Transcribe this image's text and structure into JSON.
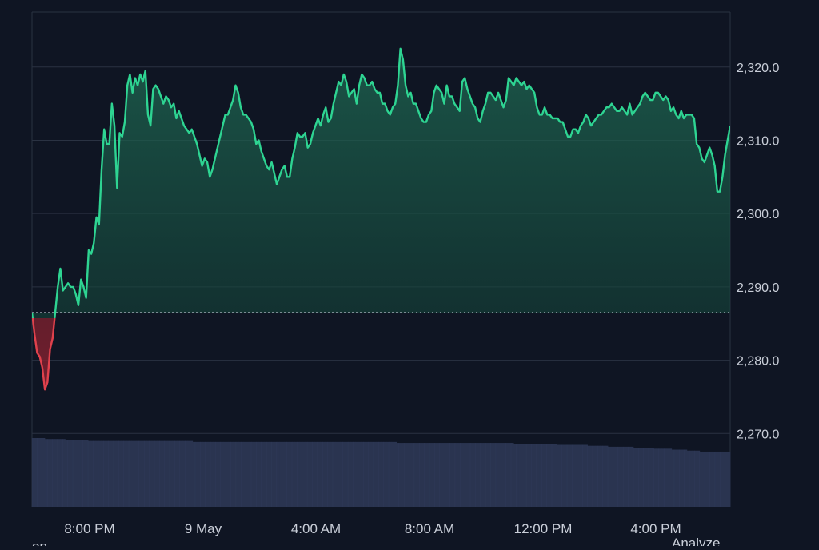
{
  "chart_data": {
    "type": "line",
    "baseline": 2286.5,
    "ylim": [
      2260,
      2327.5
    ],
    "y_ticks": [
      {
        "value": 2270,
        "label": "2,270.0"
      },
      {
        "value": 2280,
        "label": "2,280.0"
      },
      {
        "value": 2290,
        "label": "2,290.0"
      },
      {
        "value": 2300,
        "label": "2,300.0"
      },
      {
        "value": 2310,
        "label": "2,310.0"
      },
      {
        "value": 2320,
        "label": "2,320.0"
      }
    ],
    "x_ticks": [
      "8:00 PM",
      "9 May",
      "4:00 AM",
      "8:00 AM",
      "12:00 PM",
      "4:00 PM"
    ],
    "partial_labels": {
      "left": "on",
      "right": "Analyze"
    },
    "colors": {
      "up": "#2ed492",
      "down": "#e0414c",
      "volume": "#2a3450",
      "grid": "#2a3242",
      "baseline": "#b8bfcc"
    },
    "series": [
      {
        "values": [
          2286.5,
          2283.5,
          2281,
          2280.5,
          2279,
          2276,
          2277,
          2281.5,
          2283,
          2286.5,
          2290,
          2292.5,
          2289.5,
          2290,
          2290.5,
          2290,
          2290,
          2289,
          2287.5,
          2291,
          2290,
          2288.5,
          2295,
          2294.5,
          2296,
          2299.5,
          2298.5,
          2306,
          2311.5,
          2309.5,
          2309.5,
          2315,
          2312,
          2303.5,
          2311,
          2310.5,
          2312.5,
          2317.5,
          2319,
          2316.5,
          2318.5,
          2317.5,
          2319,
          2318,
          2319.5,
          2313.5,
          2312,
          2317,
          2317.5,
          2317,
          2316,
          2315,
          2316,
          2315.5,
          2314.5,
          2315,
          2313,
          2314,
          2313,
          2312,
          2311.5,
          2311,
          2311.5,
          2310.5,
          2309.5,
          2308,
          2306.5,
          2307.5,
          2307,
          2305,
          2306,
          2307.5,
          2309,
          2310.5,
          2312,
          2313.5,
          2313.5,
          2314.5,
          2315.5,
          2317.5,
          2316.5,
          2314.5,
          2313.5,
          2313.5,
          2313,
          2312.5,
          2311.5,
          2309.5,
          2310,
          2308.5,
          2307.5,
          2306.5,
          2306,
          2307,
          2305.5,
          2304,
          2305,
          2306,
          2306.5,
          2305,
          2305,
          2307.5,
          2309,
          2311,
          2310.5,
          2310.5,
          2311,
          2309,
          2309.5,
          2311,
          2312,
          2313,
          2312,
          2313.5,
          2314.5,
          2312.5,
          2313,
          2315,
          2316.5,
          2318,
          2317.5,
          2319,
          2318,
          2316,
          2316.5,
          2317,
          2315,
          2317.5,
          2319,
          2318.5,
          2317.5,
          2317.5,
          2318,
          2317,
          2316.5,
          2316.5,
          2315,
          2315,
          2314,
          2313.5,
          2314.5,
          2315,
          2317.5,
          2322.5,
          2321,
          2317.5,
          2316,
          2316.5,
          2315,
          2315,
          2314,
          2313,
          2312.5,
          2312.5,
          2313.5,
          2314,
          2316.5,
          2317.5,
          2317,
          2316.5,
          2315,
          2317.5,
          2316,
          2316,
          2315,
          2314.5,
          2314,
          2318,
          2318.5,
          2317,
          2316,
          2315,
          2314.5,
          2313,
          2312.5,
          2314,
          2315,
          2316.5,
          2316.5,
          2316,
          2315.5,
          2316.5,
          2315.5,
          2314.5,
          2315.5,
          2318.5,
          2318,
          2317.5,
          2318.5,
          2318,
          2317.5,
          2318,
          2317,
          2317.5,
          2317,
          2316.5,
          2314.5,
          2313.5,
          2313.5,
          2314.5,
          2313.5,
          2313.5,
          2313,
          2313,
          2313,
          2312.5,
          2312.5,
          2311.5,
          2310.5,
          2310.5,
          2311.5,
          2311.5,
          2311,
          2312,
          2312.5,
          2313.5,
          2313,
          2312,
          2312.5,
          2313,
          2313.5,
          2313.5,
          2314,
          2314.5,
          2314.5,
          2315,
          2314.5,
          2314,
          2314,
          2314.5,
          2314,
          2313.5,
          2315,
          2313.5,
          2314,
          2314.5,
          2315,
          2316,
          2316.5,
          2316,
          2315.5,
          2315.5,
          2316.5,
          2316.5,
          2316,
          2315.5,
          2316,
          2315.5,
          2314,
          2314.5,
          2313.5,
          2313,
          2314,
          2313,
          2313.5,
          2313.5,
          2313.5,
          2313,
          2309.5,
          2309,
          2307.5,
          2307,
          2308,
          2309,
          2308,
          2306.5,
          2303,
          2303,
          2305,
          2308,
          2310,
          2312
        ]
      }
    ],
    "volume": [
      71,
      71,
      71,
      71,
      71,
      70,
      70,
      70,
      70,
      70,
      70,
      70,
      70,
      69,
      69,
      69,
      69,
      69,
      69,
      69,
      69,
      69,
      68,
      68,
      68,
      68,
      68,
      68,
      68,
      68,
      68,
      68,
      68,
      68,
      68,
      68,
      68,
      68,
      68,
      68,
      68,
      68,
      68,
      68,
      68,
      68,
      68,
      68,
      68,
      68,
      68,
      68,
      68,
      68,
      68,
      68,
      68,
      68,
      68,
      68,
      68,
      68,
      68,
      67,
      67,
      67,
      67,
      67,
      67,
      67,
      67,
      67,
      67,
      67,
      67,
      67,
      67,
      67,
      67,
      67,
      67,
      67,
      67,
      67,
      67,
      67,
      67,
      67,
      67,
      67,
      67,
      67,
      67,
      67,
      67,
      67,
      67,
      67,
      67,
      67,
      67,
      67,
      67,
      67,
      67,
      67,
      67,
      67,
      67,
      67,
      67,
      67,
      67,
      67,
      67,
      67,
      67,
      67,
      67,
      67,
      67,
      67,
      67,
      67,
      67,
      67,
      67,
      67,
      67,
      67,
      67,
      67,
      67,
      67,
      67,
      67,
      67,
      67,
      67,
      67,
      67,
      67,
      67,
      66,
      66,
      66,
      66,
      66,
      66,
      66,
      66,
      66,
      66,
      66,
      66,
      66,
      66,
      66,
      66,
      66,
      66,
      66,
      66,
      66,
      66,
      66,
      66,
      66,
      66,
      66,
      66,
      66,
      66,
      66,
      66,
      66,
      66,
      66,
      66,
      66,
      66,
      66,
      66,
      66,
      66,
      66,
      66,
      66,
      66,
      65,
      65,
      65,
      65,
      65,
      65,
      65,
      65,
      65,
      65,
      65,
      65,
      65,
      65,
      65,
      65,
      65,
      64,
      64,
      64,
      64,
      64,
      64,
      64,
      64,
      64,
      64,
      64,
      64,
      63,
      63,
      63,
      63,
      63,
      63,
      63,
      63,
      62,
      62,
      62,
      62,
      62,
      62,
      62,
      62,
      62,
      62,
      61,
      61,
      61,
      61,
      61,
      61,
      61,
      61,
      60,
      60,
      60,
      60,
      60,
      60,
      60,
      59,
      59,
      59,
      59,
      59,
      59,
      58,
      58,
      58,
      58,
      58,
      57,
      57,
      57,
      57,
      57,
      57,
      57,
      57,
      57,
      57,
      57,
      57
    ]
  }
}
